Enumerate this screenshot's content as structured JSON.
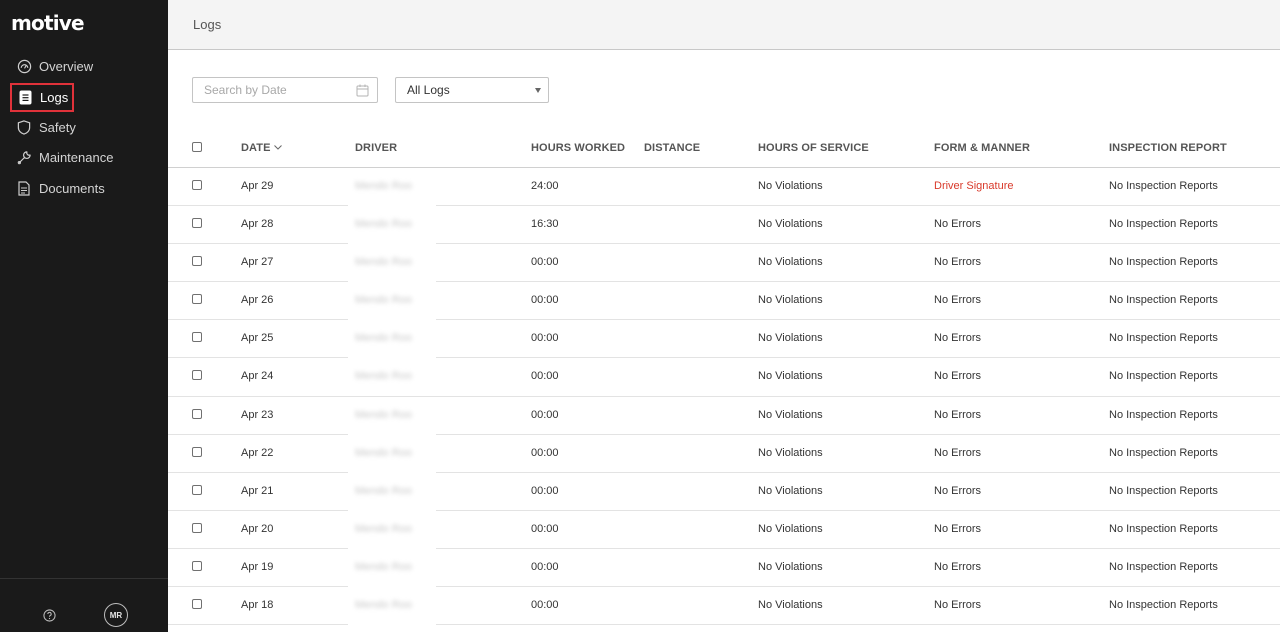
{
  "app": {
    "logo": "motive"
  },
  "sidebar": {
    "items": [
      {
        "label": "Overview",
        "icon": "gauge-icon"
      },
      {
        "label": "Logs",
        "icon": "logs-icon",
        "active": true
      },
      {
        "label": "Safety",
        "icon": "shield-icon"
      },
      {
        "label": "Maintenance",
        "icon": "wrench-icon"
      },
      {
        "label": "Documents",
        "icon": "document-icon"
      }
    ],
    "footer": {
      "help_icon": "help-icon",
      "avatar_initials": "MR"
    }
  },
  "header": {
    "title": "Logs"
  },
  "filters": {
    "search_placeholder": "Search by Date",
    "logs_select_value": "All Logs"
  },
  "table": {
    "columns": [
      "DATE",
      "DRIVER",
      "HOURS WORKED",
      "DISTANCE",
      "HOURS OF SERVICE",
      "FORM & MANNER",
      "INSPECTION REPORT"
    ],
    "rows": [
      {
        "date": "Apr 29",
        "driver": "Mendo Roo",
        "hours_worked": "24:00",
        "distance": "",
        "hos": "No Violations",
        "form": "Driver Signature",
        "inspection": "No Inspection Reports"
      },
      {
        "date": "Apr 28",
        "driver": "Mendo Roo",
        "hours_worked": "16:30",
        "distance": "",
        "hos": "No Violations",
        "form": "No Errors",
        "inspection": "No Inspection Reports"
      },
      {
        "date": "Apr 27",
        "driver": "Mendo Roo",
        "hours_worked": "00:00",
        "distance": "",
        "hos": "No Violations",
        "form": "No Errors",
        "inspection": "No Inspection Reports"
      },
      {
        "date": "Apr 26",
        "driver": "Mendo Roo",
        "hours_worked": "00:00",
        "distance": "",
        "hos": "No Violations",
        "form": "No Errors",
        "inspection": "No Inspection Reports"
      },
      {
        "date": "Apr 25",
        "driver": "Mendo Roo",
        "hours_worked": "00:00",
        "distance": "",
        "hos": "No Violations",
        "form": "No Errors",
        "inspection": "No Inspection Reports"
      },
      {
        "date": "Apr 24",
        "driver": "Mendo Roo",
        "hours_worked": "00:00",
        "distance": "",
        "hos": "No Violations",
        "form": "No Errors",
        "inspection": "No Inspection Reports"
      },
      {
        "date": "Apr 23",
        "driver": "Mendo Roo",
        "hours_worked": "00:00",
        "distance": "",
        "hos": "No Violations",
        "form": "No Errors",
        "inspection": "No Inspection Reports"
      },
      {
        "date": "Apr 22",
        "driver": "Mendo Roo",
        "hours_worked": "00:00",
        "distance": "",
        "hos": "No Violations",
        "form": "No Errors",
        "inspection": "No Inspection Reports"
      },
      {
        "date": "Apr 21",
        "driver": "Mendo Roo",
        "hours_worked": "00:00",
        "distance": "",
        "hos": "No Violations",
        "form": "No Errors",
        "inspection": "No Inspection Reports"
      },
      {
        "date": "Apr 20",
        "driver": "Mendo Roo",
        "hours_worked": "00:00",
        "distance": "",
        "hos": "No Violations",
        "form": "No Errors",
        "inspection": "No Inspection Reports"
      },
      {
        "date": "Apr 19",
        "driver": "Mendo Roo",
        "hours_worked": "00:00",
        "distance": "",
        "hos": "No Violations",
        "form": "No Errors",
        "inspection": "No Inspection Reports"
      },
      {
        "date": "Apr 18",
        "driver": "Mendo Roo",
        "hours_worked": "00:00",
        "distance": "",
        "hos": "No Violations",
        "form": "No Errors",
        "inspection": "No Inspection Reports"
      }
    ]
  },
  "colors": {
    "sidebar_bg": "#1a1a1a",
    "active_outline": "#e0323a",
    "error_text": "#d93a2b"
  }
}
